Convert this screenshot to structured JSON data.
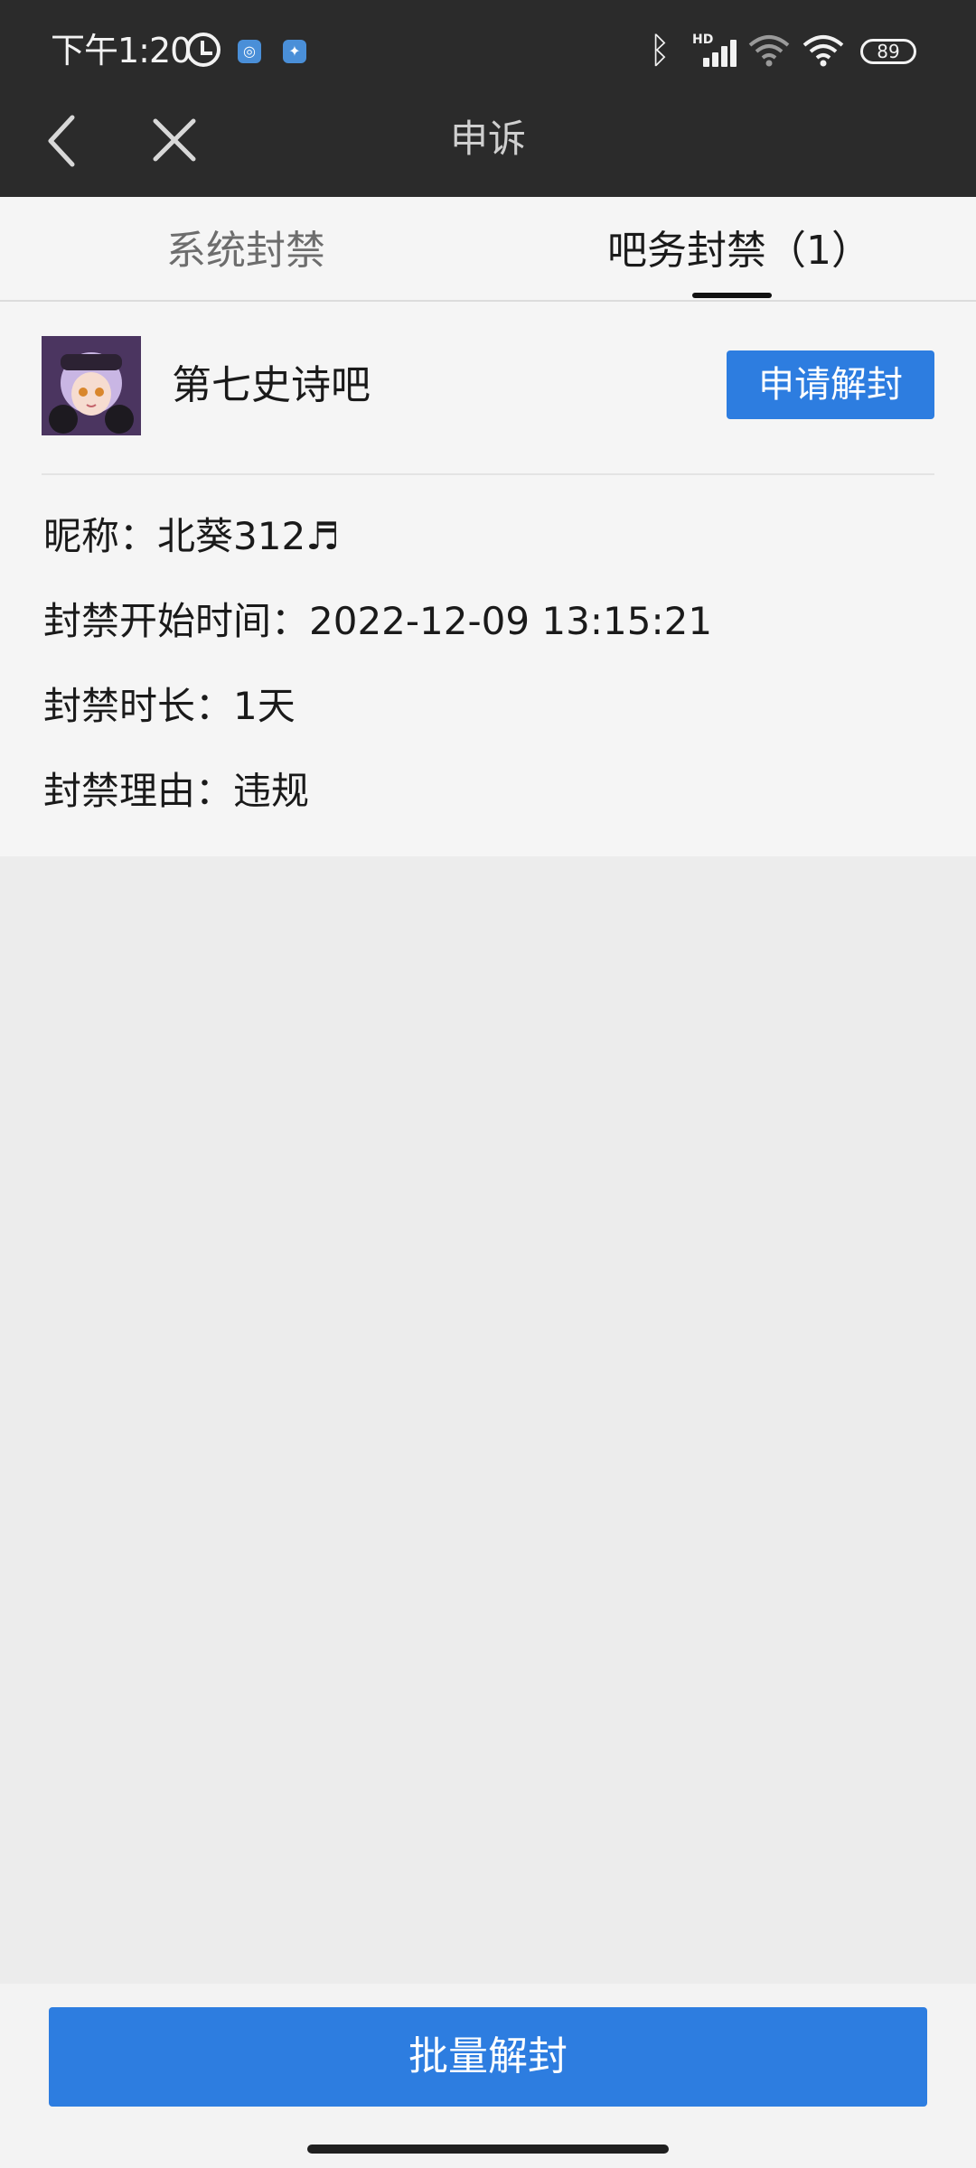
{
  "status_bar": {
    "time": "下午1:20",
    "battery": "89",
    "signal_label": "HD",
    "icons": [
      "alarm-icon",
      "app-notification-icon",
      "app-notification-icon",
      "bluetooth-icon",
      "cellular-signal-icon",
      "wifi-icon",
      "wifi-icon",
      "battery-icon"
    ]
  },
  "nav": {
    "title": "申诉",
    "back_icon": "chevron-left-icon",
    "close_icon": "close-icon"
  },
  "tabs": [
    {
      "label": "系统封禁",
      "active": false
    },
    {
      "label": "吧务封禁（1）",
      "active": true
    }
  ],
  "ban": {
    "forum_name": "第七史诗吧",
    "apply_label": "申请解封",
    "nickname": "昵称：北葵312♬",
    "start_time": "封禁开始时间：2022-12-09 13:15:21",
    "duration": "封禁时长：1天",
    "reason": "封禁理由：违规"
  },
  "footer": {
    "batch_label": "批量解封"
  },
  "colors": {
    "accent": "#2d7de0",
    "topbar": "#2b2b2b",
    "background": "#ececec"
  }
}
